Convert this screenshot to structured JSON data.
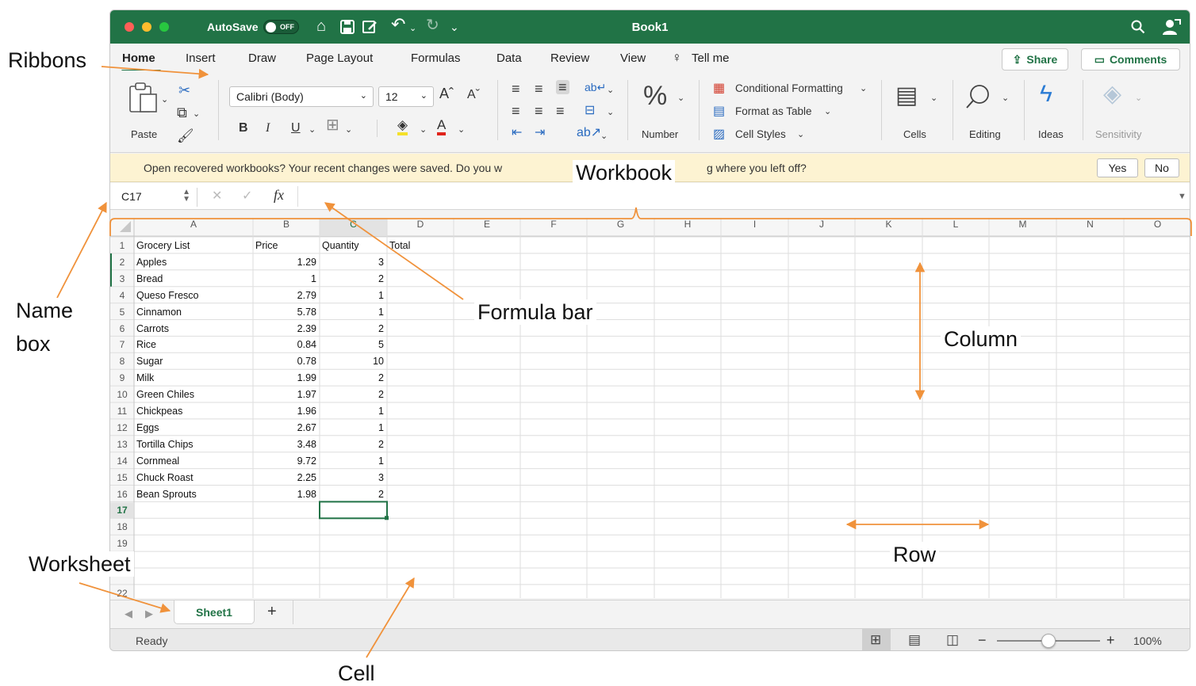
{
  "window": {
    "title": "Book1",
    "autosave_label": "AutoSave",
    "autosave_state": "OFF",
    "accent_color": "#217346"
  },
  "ribbon_tabs": [
    "Home",
    "Insert",
    "Draw",
    "Page Layout",
    "Formulas",
    "Data",
    "Review",
    "View"
  ],
  "tell_me": "Tell me",
  "share_label": "Share",
  "comments_label": "Comments",
  "ribbon": {
    "paste": "Paste",
    "font_name": "Calibri (Body)",
    "font_size": "12",
    "bold": "B",
    "italic": "I",
    "underline": "U",
    "number": "Number",
    "conditional_formatting": "Conditional Formatting",
    "format_as_table": "Format as Table",
    "cell_styles": "Cell Styles",
    "cells": "Cells",
    "editing": "Editing",
    "ideas": "Ideas",
    "sensitivity": "Sensitivity"
  },
  "infobar": {
    "message_left": "Open recovered workbooks?  Your recent changes were saved. Do you w",
    "message_right": "g where you left off?",
    "yes": "Yes",
    "no": "No"
  },
  "formula_bar": {
    "name_box": "C17",
    "fx": "fx"
  },
  "columns": [
    "A",
    "B",
    "C",
    "D",
    "E",
    "F",
    "G",
    "H",
    "I",
    "J",
    "K",
    "L",
    "M",
    "N",
    "O"
  ],
  "rows": [
    {
      "n": "1",
      "a": "Grocery List",
      "b": "Price",
      "c": "Quantity",
      "d": "Total"
    },
    {
      "n": "2",
      "a": "Apples",
      "b": "1.29",
      "c": "3",
      "d": ""
    },
    {
      "n": "3",
      "a": "Bread",
      "b": "1",
      "c": "2",
      "d": ""
    },
    {
      "n": "4",
      "a": "Queso Fresco",
      "b": "2.79",
      "c": "1",
      "d": ""
    },
    {
      "n": "5",
      "a": "Cinnamon",
      "b": "5.78",
      "c": "1",
      "d": ""
    },
    {
      "n": "6",
      "a": "Carrots",
      "b": "2.39",
      "c": "2",
      "d": ""
    },
    {
      "n": "7",
      "a": "Rice",
      "b": "0.84",
      "c": "5",
      "d": ""
    },
    {
      "n": "8",
      "a": "Sugar",
      "b": "0.78",
      "c": "10",
      "d": ""
    },
    {
      "n": "9",
      "a": "Milk",
      "b": "1.99",
      "c": "2",
      "d": ""
    },
    {
      "n": "10",
      "a": "Green Chiles",
      "b": "1.97",
      "c": "2",
      "d": ""
    },
    {
      "n": "11",
      "a": "Chickpeas",
      "b": "1.96",
      "c": "1",
      "d": ""
    },
    {
      "n": "12",
      "a": "Eggs",
      "b": "2.67",
      "c": "1",
      "d": ""
    },
    {
      "n": "13",
      "a": "Tortilla Chips",
      "b": "3.48",
      "c": "2",
      "d": ""
    },
    {
      "n": "14",
      "a": "Cornmeal",
      "b": "9.72",
      "c": "1",
      "d": ""
    },
    {
      "n": "15",
      "a": "Chuck Roast",
      "b": "2.25",
      "c": "3",
      "d": ""
    },
    {
      "n": "16",
      "a": "Bean Sprouts",
      "b": "1.98",
      "c": "2",
      "d": ""
    },
    {
      "n": "17",
      "a": "",
      "b": "",
      "c": "",
      "d": ""
    },
    {
      "n": "18",
      "a": "",
      "b": "",
      "c": "",
      "d": ""
    },
    {
      "n": "19",
      "a": "",
      "b": "",
      "c": "",
      "d": ""
    },
    {
      "n": "",
      "a": "",
      "b": "",
      "c": "",
      "d": ""
    },
    {
      "n": "",
      "a": "",
      "b": "",
      "c": "",
      "d": ""
    },
    {
      "n": "22",
      "a": "",
      "b": "",
      "c": "",
      "d": ""
    }
  ],
  "sheet_tab": "Sheet1",
  "add_sheet": "+",
  "status": {
    "ready": "Ready",
    "zoom": "100%",
    "zoom_minus": "−",
    "zoom_plus": "+",
    "zoom_level": 0.5
  },
  "annotations": {
    "ribbons": "Ribbons",
    "workbook": "Workbook",
    "name_box_line1": "Name",
    "name_box_line2": "box",
    "formula_bar": "Formula bar",
    "column": "Column",
    "row": "Row",
    "worksheet": "Worksheet",
    "cell": "Cell",
    "arrow_color": "#f0923b"
  },
  "icons": {
    "home": "home-icon",
    "save": "save-icon",
    "edit": "edit-icon",
    "undo": "undo-icon",
    "redo": "redo-icon",
    "search": "search-icon",
    "user": "user-icon",
    "lightbulb": "lightbulb-icon"
  }
}
